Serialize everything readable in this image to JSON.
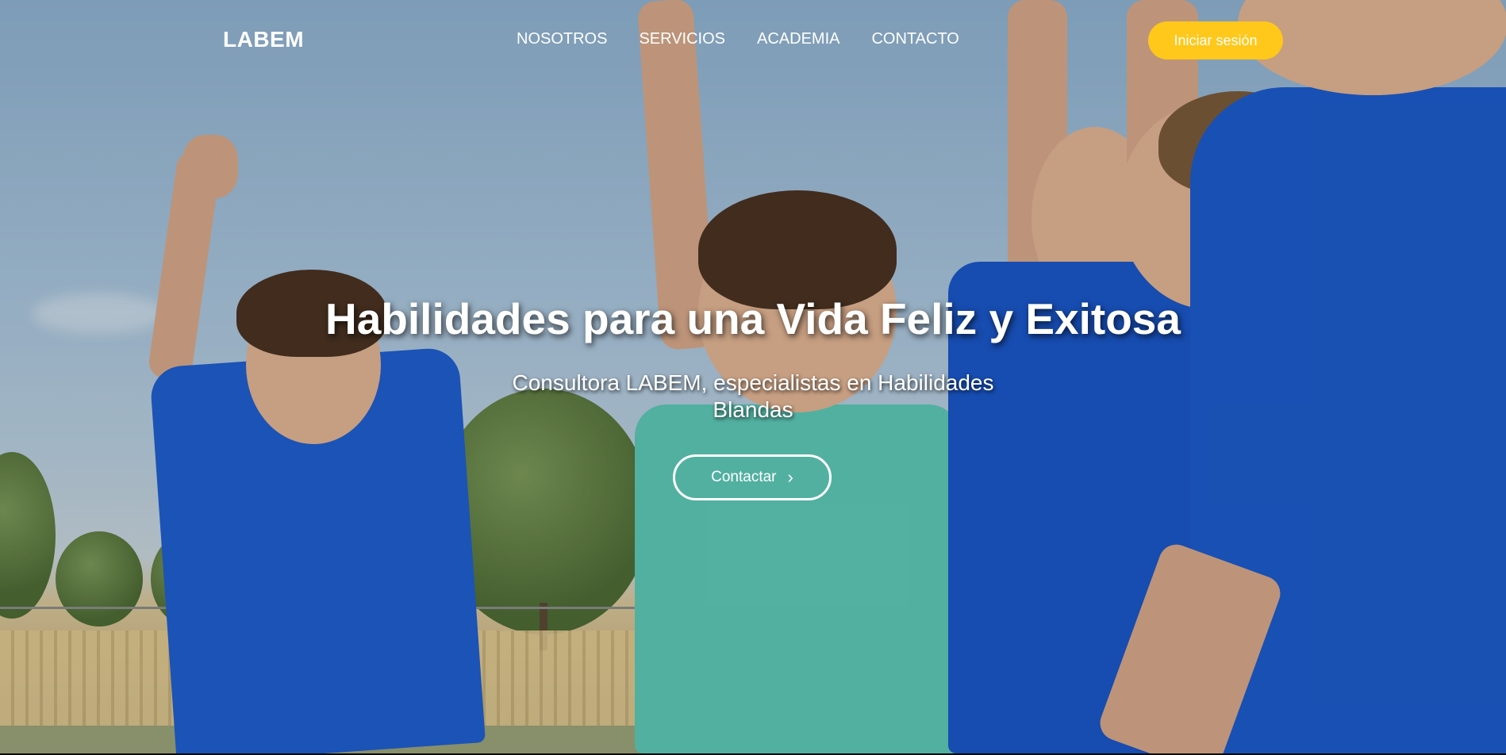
{
  "nav": {
    "logo": "LABEM",
    "items": [
      {
        "label": "NOSOTROS"
      },
      {
        "label": "SERVICIOS"
      },
      {
        "label": "ACADEMIA"
      },
      {
        "label": "CONTACTO"
      }
    ],
    "login_label": "Iniciar sesión"
  },
  "hero": {
    "title": "Habilidades para una Vida Feliz y Exitosa",
    "subtitle": "Consultora LABEM, especialistas en Habilidades Blandas",
    "cta_label": "Contactar",
    "cta_icon": "chevron-right-icon"
  },
  "colors": {
    "accent": "#ffc81a",
    "text": "#ffffff",
    "shirt_blue": "#1e5fcf",
    "shirt_teal": "#5ec9b8"
  }
}
